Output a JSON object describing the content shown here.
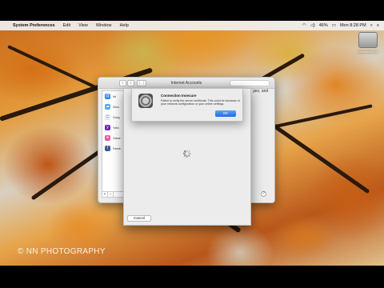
{
  "menubar": {
    "app_name": "System Preferences",
    "items": [
      "Edit",
      "View",
      "Window",
      "Help"
    ],
    "battery": "46%",
    "clock": "Mon 8:28 PM"
  },
  "desktop": {
    "disk_label": "Macintosh HD",
    "watermark": "© NN PHOTOGRAPHY"
  },
  "prefs_window": {
    "title": "Internet Accounts",
    "nav_back": "‹",
    "nav_forward": "›",
    "right_text": "ges, and",
    "accounts": [
      {
        "label": "Int",
        "icon": "at-icon",
        "color": "#2e86de",
        "glyph": "@"
      },
      {
        "label": "iClou",
        "icon": "cloud-icon",
        "color": "#5aa9f0",
        "glyph": "☁"
      },
      {
        "label": "Goog",
        "icon": "google-icon",
        "color": "#ffffff",
        "glyph": "G"
      },
      {
        "label": "Yaho",
        "icon": "yahoo-icon",
        "color": "#6b2bb3",
        "glyph": "y"
      },
      {
        "label": "Game",
        "icon": "game-center-icon",
        "color": "#e65aa0",
        "glyph": "●"
      },
      {
        "label": "Faceb",
        "icon": "facebook-icon",
        "color": "#3b5998",
        "glyph": "f"
      }
    ],
    "footer_buttons": [
      "+",
      "−"
    ]
  },
  "sheet": {
    "cancel_label": "Cancel"
  },
  "alert": {
    "title": "Connection Insecure",
    "message": "Failed to verify the server certificate. This could be because of your network configuration or your online settings.",
    "ok_label": "OK"
  }
}
